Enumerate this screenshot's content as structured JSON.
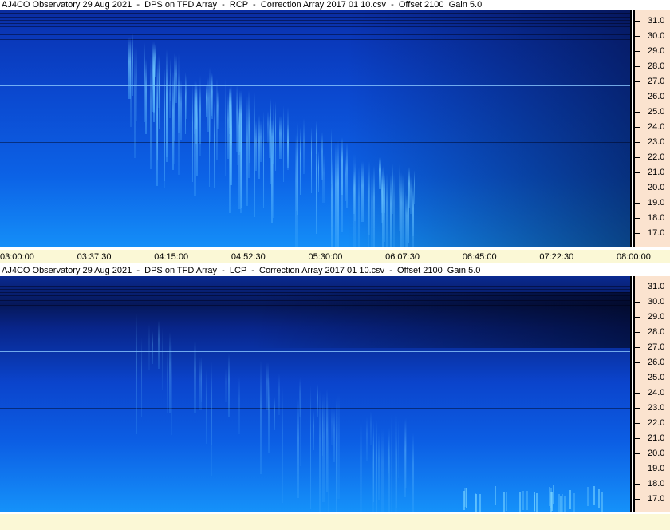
{
  "panels": [
    {
      "title": "AJ4CO Observatory 29 Aug 2021  -  DPS on TFD Array  -  RCP  -  Correction Array 2017 01 10.csv  -  Offset 2100  Gain 5.0",
      "polarization": "RCP"
    },
    {
      "title": "AJ4CO Observatory 29 Aug 2021  -  DPS on TFD Array  -  LCP  -  Correction Array 2017 01 10.csv  -  Offset 2100  Gain 5.0",
      "polarization": "LCP"
    }
  ],
  "y_axis_labels": [
    "31.0",
    "30.0",
    "29.0",
    "28.0",
    "27.0",
    "26.0",
    "25.0",
    "24.0",
    "23.0",
    "22.0",
    "21.0",
    "20.0",
    "19.0",
    "18.0",
    "17.0"
  ],
  "time_labels": [
    "03:00:00",
    "03:37:30",
    "04:15:00",
    "04:52:30",
    "05:30:00",
    "06:07:30",
    "06:45:00",
    "07:22:30",
    "08:00:00"
  ],
  "colors": {
    "spectrogram_bright": "#1ea0ff",
    "spectrogram_mid": "#0a4ad6",
    "spectrogram_dark": "#020a3a",
    "frequency_axis_bg": "#fbe3cf",
    "time_axis_bg": "#fbf8d6"
  }
}
